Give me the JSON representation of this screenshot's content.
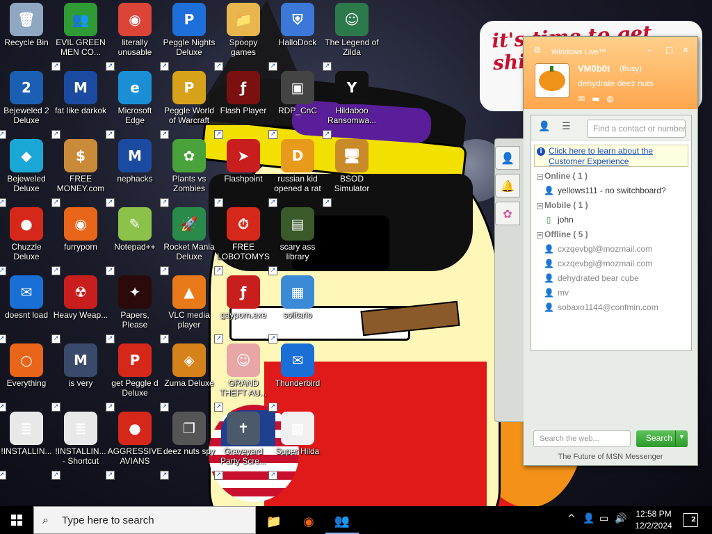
{
  "desktop": {
    "wallpaper_text": "it's time to get shit and or t",
    "icons": [
      {
        "label": "Recycle Bin",
        "icon": "recycle-bin-icon",
        "color": "#8fa7c2",
        "glyph": "🗑"
      },
      {
        "label": "EVIL GREEN MEN CO...",
        "icon": "msn-people-icon",
        "color": "#2e9b35",
        "glyph": "👥"
      },
      {
        "label": "literally unusable",
        "icon": "chrome-icon",
        "color": "#db4437",
        "glyph": "◉"
      },
      {
        "label": "Peggle Nights Deluxe",
        "icon": "peggle-icon",
        "color": "#1e6fd9",
        "glyph": "P"
      },
      {
        "label": "Spoopy games",
        "icon": "folder-icon",
        "color": "#e8b64c",
        "glyph": "📁"
      },
      {
        "label": "HalloDock",
        "icon": "shield-icon",
        "color": "#3b78d8",
        "glyph": "⛨"
      },
      {
        "label": "The Legend of Zilda",
        "icon": "game-character-icon",
        "color": "#2c7a4b",
        "glyph": "☺"
      },
      {
        "label": "Bejeweled 2 Deluxe",
        "icon": "bejeweled-2-icon",
        "color": "#1b5fb3",
        "glyph": "2"
      },
      {
        "label": "fat like darkok",
        "icon": "mpl-icon",
        "color": "#1a4ba0",
        "glyph": "M"
      },
      {
        "label": "Microsoft Edge",
        "icon": "edge-icon",
        "color": "#1a8fd6",
        "glyph": "e"
      },
      {
        "label": "Peggle World of Warcraft",
        "icon": "peggle-icon",
        "color": "#d6a21a",
        "glyph": "P"
      },
      {
        "label": "Flash Player",
        "icon": "flash-icon",
        "color": "#7a1010",
        "glyph": "ƒ"
      },
      {
        "label": "RDP_CnC",
        "icon": "remote-desktop-icon",
        "color": "#444444",
        "glyph": "▣"
      },
      {
        "label": "Hildaboo Ransomwa...",
        "icon": "yashma-icon",
        "color": "#111111",
        "glyph": "Y"
      },
      {
        "label": "Bejeweled Deluxe",
        "icon": "gem-icon",
        "color": "#1aa7d6",
        "glyph": "◆"
      },
      {
        "label": "FREE MONEY.com",
        "icon": "money-bag-icon",
        "color": "#c98b3a",
        "glyph": "$"
      },
      {
        "label": "nephacks",
        "icon": "mpi-icon",
        "color": "#1a4ba0",
        "glyph": "M"
      },
      {
        "label": "Plants vs Zombies",
        "icon": "plants-icon",
        "color": "#4aa33a",
        "glyph": "✿"
      },
      {
        "label": "Flashpoint",
        "icon": "flashpoint-icon",
        "color": "#c81e1e",
        "glyph": "➤"
      },
      {
        "label": "russian kid opened a rat",
        "icon": "de-icon",
        "color": "#e89a1a",
        "glyph": "D"
      },
      {
        "label": "BSOD Simulator",
        "icon": "computer-icon",
        "color": "#c98b2a",
        "glyph": "🖥"
      },
      {
        "label": "Chuzzle Deluxe",
        "icon": "chuzzle-icon",
        "color": "#d6281a",
        "glyph": "●"
      },
      {
        "label": "furryporn",
        "icon": "firefox-icon",
        "color": "#e8651a",
        "glyph": "◉"
      },
      {
        "label": "Notepad++",
        "icon": "notepad-icon",
        "color": "#8ac24a",
        "glyph": "✎"
      },
      {
        "label": "Rocket Mania Deluxe",
        "icon": "rocket-icon",
        "color": "#2a8a4a",
        "glyph": "🚀"
      },
      {
        "label": "FREE LOBOTOMYS",
        "icon": "stopwatch-icon",
        "color": "#d6281a",
        "glyph": "⏱"
      },
      {
        "label": "scary ass library",
        "icon": "library-icon",
        "color": "#3a5a2a",
        "glyph": "▤"
      },
      {
        "label": "doesnt load",
        "icon": "thunderbird-icon",
        "color": "#1a6fd6",
        "glyph": "✉"
      },
      {
        "label": "Heavy Weap...",
        "icon": "radiation-icon",
        "color": "#c81e1e",
        "glyph": "☢"
      },
      {
        "label": "Papers, Please",
        "icon": "papers-please-icon",
        "color": "#2a0a0a",
        "glyph": "✦"
      },
      {
        "label": "VLC media player",
        "icon": "vlc-icon",
        "color": "#e87a1a",
        "glyph": "▲"
      },
      {
        "label": "gayporn.exe",
        "icon": "flash-icon",
        "color": "#c81e1e",
        "glyph": "ƒ"
      },
      {
        "label": "solitario",
        "icon": "solitaire-icon",
        "color": "#3a8ad6",
        "glyph": "▦"
      },
      {
        "label": "Everything",
        "icon": "search-ring-icon",
        "color": "#e8651a",
        "glyph": "○"
      },
      {
        "label": "is very",
        "icon": "mpl-shield-icon",
        "color": "#3a4a6a",
        "glyph": "M"
      },
      {
        "label": "get Peggle d Deluxe",
        "icon": "peggle-icon",
        "color": "#d6281a",
        "glyph": "P"
      },
      {
        "label": "Zuma Deluxe",
        "icon": "zuma-icon",
        "color": "#d6821a",
        "glyph": "◈"
      },
      {
        "label": "GRAND THEFT AU...",
        "icon": "anime-girl-icon",
        "color": "#e8a6a6",
        "glyph": "☺"
      },
      {
        "label": "Thunderbird",
        "icon": "thunderbird-icon",
        "color": "#1a6fd6",
        "glyph": "✉"
      },
      {
        "label": "!INSTALLIN...",
        "icon": "document-icon",
        "color": "#e8e8e8",
        "glyph": "≣"
      },
      {
        "label": "!INSTALLIN... - Shortcut",
        "icon": "document-icon",
        "color": "#e8e8e8",
        "glyph": "≣"
      },
      {
        "label": "AGGRESSIVE AVIANS",
        "icon": "angry-bird-icon",
        "color": "#d6281a",
        "glyph": "●"
      },
      {
        "label": "deez nuts spy",
        "icon": "windows-stack-icon",
        "color": "#555555",
        "glyph": "❐"
      },
      {
        "label": "Graveyard Party Scre...",
        "icon": "graveyard-icon",
        "color": "#4a5a6a",
        "glyph": "✝"
      },
      {
        "label": "Super Hilda",
        "icon": "pixel-character-icon",
        "color": "#f0f0f0",
        "glyph": "▩"
      }
    ]
  },
  "msn": {
    "title": "Windows Live™",
    "display_name": "VM0b0t",
    "status": "(Busy)",
    "personal_message": "dehydrate deez nuts",
    "find_placeholder": "Find a contact or number",
    "info_text": "Click here to learn about the Customer Experience",
    "groups": [
      {
        "label": "Online ( 1 )",
        "contacts": [
          {
            "name": "yellows111 - no switchboard?",
            "state": "online"
          }
        ]
      },
      {
        "label": "Mobile ( 1 )",
        "contacts": [
          {
            "name": "john",
            "state": "mobile"
          }
        ]
      },
      {
        "label": "Offline ( 5 )",
        "contacts": [
          {
            "name": "cxzqevbgl@mozmail.com",
            "state": "offline"
          },
          {
            "name": "cxzqevbgl@mozmail.com",
            "state": "offline"
          },
          {
            "name": "dehydrated bear cube",
            "state": "offline"
          },
          {
            "name": "mv",
            "state": "offline"
          },
          {
            "name": "sobaxo1144@confmin.com",
            "state": "offline"
          }
        ]
      }
    ],
    "search_placeholder": "Search the web...",
    "search_button": "Search",
    "footer": "The Future of MSN Messenger"
  },
  "taskbar": {
    "search_placeholder": "Type here to search",
    "time": "12:58 PM",
    "date": "12/2/2024",
    "notifications": "2"
  },
  "colors": {
    "msn_header": "#ffa64d",
    "online": "#2e9b35",
    "taskbar": "#000000"
  }
}
